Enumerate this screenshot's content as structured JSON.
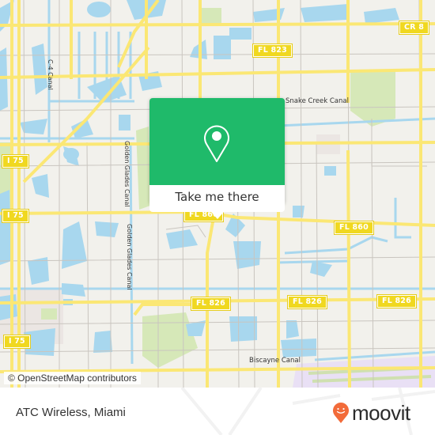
{
  "map": {
    "colors": {
      "land": "#f2f1ec",
      "water": "#a8d7ee",
      "major_road": "#fbe774",
      "minor_road": "#c9c5bf",
      "park": "#d6e8b8",
      "shield": "#f0d820",
      "urban": "#ebe6e3",
      "airport": "#e9e0f5"
    },
    "road_shields": [
      {
        "id": "cr-shield",
        "text": "CR 8"
      },
      {
        "id": "fl823-shield",
        "text": "FL 823"
      },
      {
        "id": "i75-shield-1",
        "text": "I 75"
      },
      {
        "id": "i75-shield-2",
        "text": "I 75"
      },
      {
        "id": "i75-shield-3",
        "text": "I 75"
      },
      {
        "id": "fl860-shield-1",
        "text": "FL 860"
      },
      {
        "id": "fl860-shield-2",
        "text": "FL 860"
      },
      {
        "id": "fl826-shield-1",
        "text": "FL 826"
      },
      {
        "id": "fl826-shield-2",
        "text": "FL 826"
      },
      {
        "id": "fl826-shield-3",
        "text": "FL 826"
      }
    ],
    "water_labels": {
      "c4_canal": "C-4 Canal",
      "golden_glades_canal_1": "Golden Glades Canal",
      "golden_glades_canal_2": "Golden Glades Canal",
      "snake_creek_canal": "Snake Creek Canal",
      "biscayne_canal": "Biscayne Canal"
    },
    "attribution": "© OpenStreetMap contributors"
  },
  "popup": {
    "icon": "location-pin-icon",
    "button_label": "Take me there",
    "color": "#1fba6a"
  },
  "footer": {
    "place_title": "ATC Wireless, Miami",
    "brand": "moovit",
    "brand_color": "#f26b3a"
  }
}
